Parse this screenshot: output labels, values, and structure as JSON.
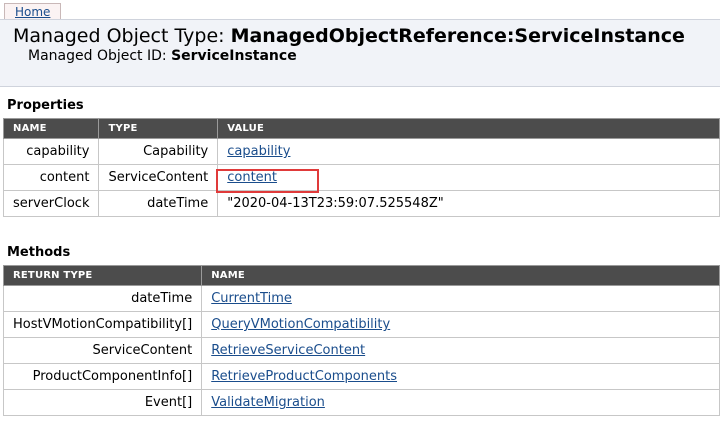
{
  "nav": {
    "home_label": "Home"
  },
  "header": {
    "type_prefix": "Managed Object Type: ",
    "type_value": "ManagedObjectReference:ServiceInstance",
    "id_prefix": "Managed Object ID: ",
    "id_value": "ServiceInstance"
  },
  "properties": {
    "title": "Properties",
    "columns": [
      "NAME",
      "TYPE",
      "VALUE"
    ],
    "rows": [
      {
        "name": "capability",
        "type": "Capability",
        "value": "capability"
      },
      {
        "name": "content",
        "type": "ServiceContent",
        "value": "content"
      },
      {
        "name": "serverClock",
        "type": "dateTime",
        "value": "\"2020-04-13T23:59:07.525548Z\""
      }
    ]
  },
  "methods": {
    "title": "Methods",
    "columns": [
      "RETURN TYPE",
      "NAME"
    ],
    "rows": [
      {
        "return_type": "dateTime",
        "name": "CurrentTime"
      },
      {
        "return_type": "HostVMotionCompatibility[]",
        "name": "QueryVMotionCompatibility"
      },
      {
        "return_type": "ServiceContent",
        "name": "RetrieveServiceContent"
      },
      {
        "return_type": "ProductComponentInfo[]",
        "name": "RetrieveProductComponents"
      },
      {
        "return_type": "Event[]",
        "name": "ValidateMigration"
      }
    ]
  },
  "colors": {
    "header_bg": "#f1f3f8",
    "table_header_bg": "#4c4c4c",
    "link": "#1a4d8c",
    "highlight": "#e03a3a"
  }
}
